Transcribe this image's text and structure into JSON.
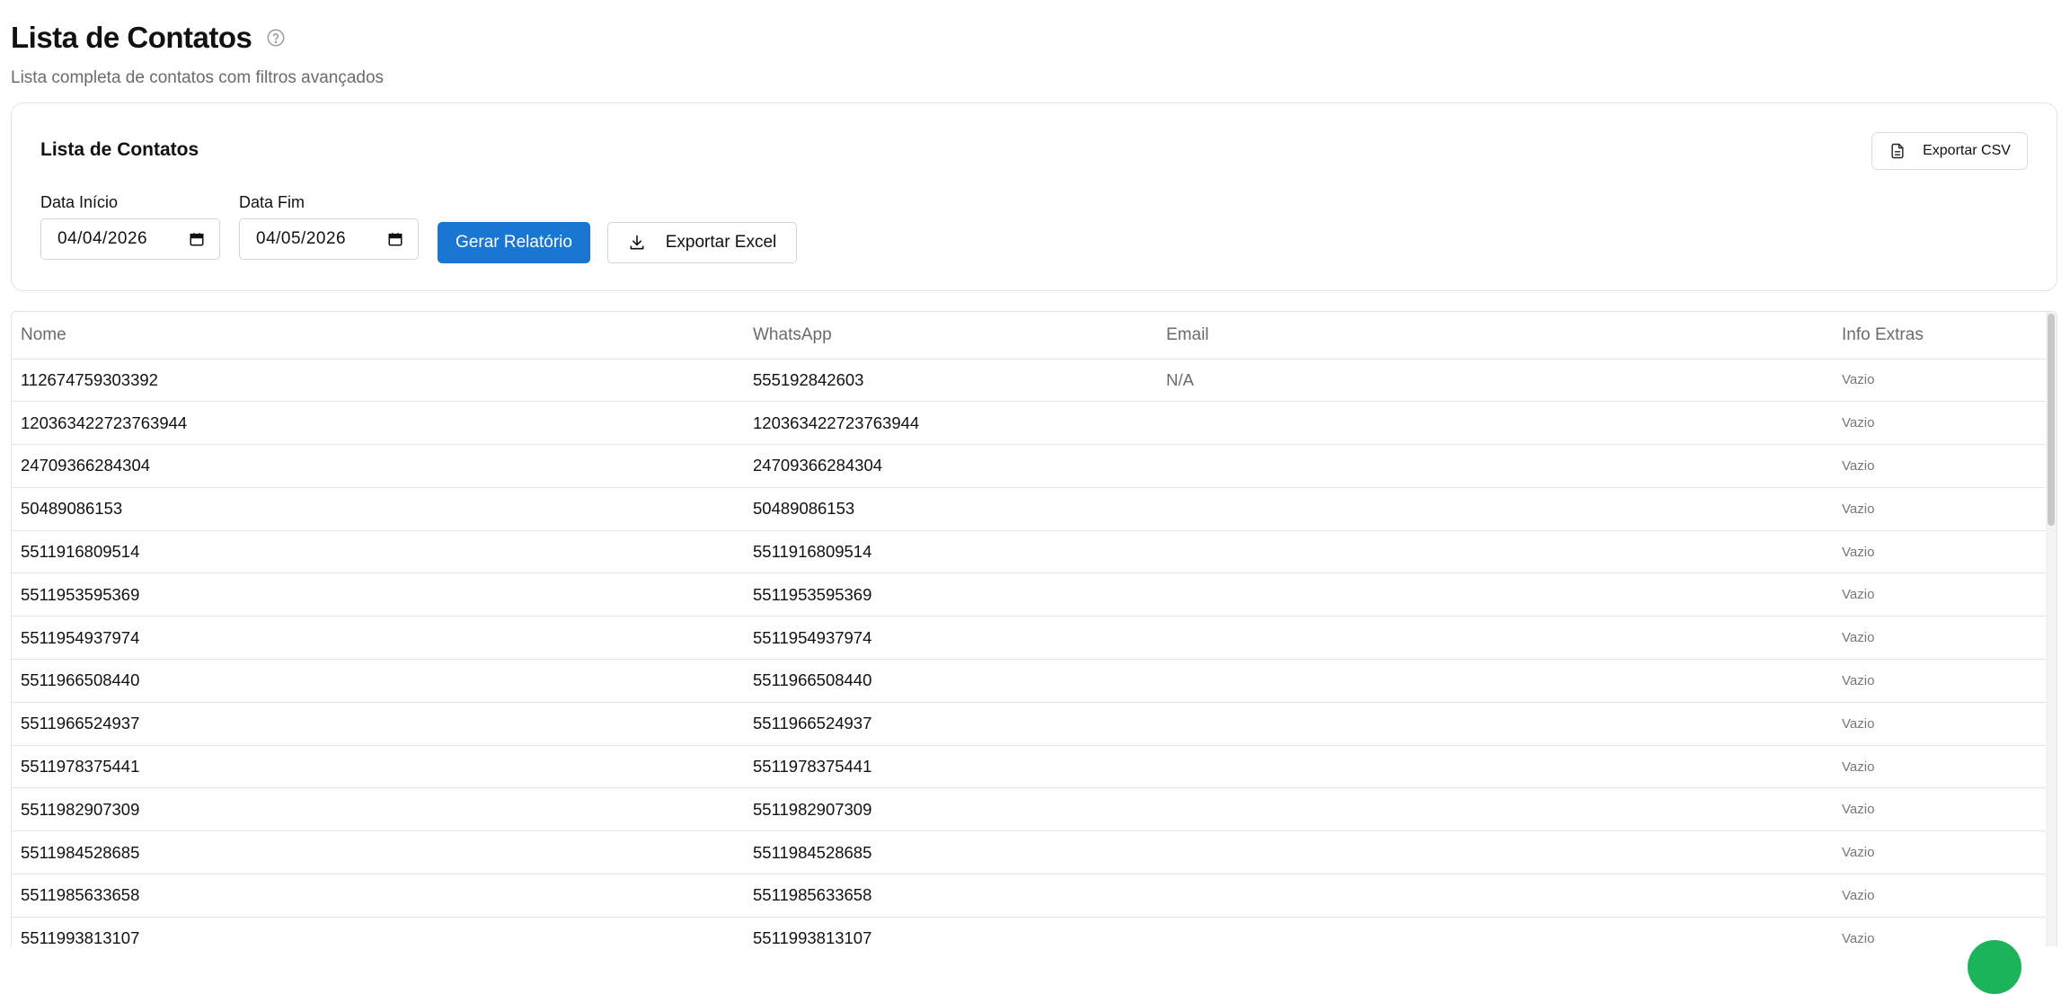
{
  "header": {
    "title": "Lista de Contatos",
    "subtitle": "Lista completa de contatos com filtros avançados",
    "help_icon": "help-circle-icon"
  },
  "filters": {
    "card_title": "Lista de Contatos",
    "export_csv_label": "Exportar CSV",
    "start_label": "Data Início",
    "start_value": "04/04/2026",
    "end_label": "Data Fim",
    "end_value": "04/05/2026",
    "generate_label": "Gerar Relatório",
    "export_excel_label": "Exportar Excel"
  },
  "table": {
    "columns": [
      "Nome",
      "WhatsApp",
      "Email",
      "Info Extras"
    ],
    "rows": [
      {
        "nome": "112674759303392",
        "whatsapp": "555192842603",
        "email": "N/A",
        "extra": "Vazio"
      },
      {
        "nome": "120363422723763944",
        "whatsapp": "120363422723763944",
        "email": "",
        "extra": "Vazio"
      },
      {
        "nome": "24709366284304",
        "whatsapp": "24709366284304",
        "email": "",
        "extra": "Vazio"
      },
      {
        "nome": "50489086153",
        "whatsapp": "50489086153",
        "email": "",
        "extra": "Vazio"
      },
      {
        "nome": "5511916809514",
        "whatsapp": "5511916809514",
        "email": "",
        "extra": "Vazio"
      },
      {
        "nome": "5511953595369",
        "whatsapp": "5511953595369",
        "email": "",
        "extra": "Vazio"
      },
      {
        "nome": "5511954937974",
        "whatsapp": "5511954937974",
        "email": "",
        "extra": "Vazio"
      },
      {
        "nome": "5511966508440",
        "whatsapp": "5511966508440",
        "email": "",
        "extra": "Vazio"
      },
      {
        "nome": "5511966524937",
        "whatsapp": "5511966524937",
        "email": "",
        "extra": "Vazio"
      },
      {
        "nome": "5511978375441",
        "whatsapp": "5511978375441",
        "email": "",
        "extra": "Vazio"
      },
      {
        "nome": "5511982907309",
        "whatsapp": "5511982907309",
        "email": "",
        "extra": "Vazio"
      },
      {
        "nome": "5511984528685",
        "whatsapp": "5511984528685",
        "email": "",
        "extra": "Vazio"
      },
      {
        "nome": "5511985633658",
        "whatsapp": "5511985633658",
        "email": "",
        "extra": "Vazio"
      },
      {
        "nome": "5511993813107",
        "whatsapp": "5511993813107",
        "email": "",
        "extra": "Vazio"
      }
    ]
  },
  "colors": {
    "primary": "#1976d2",
    "fab": "#1bb45a",
    "border": "#e4e4e7",
    "muted_text": "#6b6b6b"
  }
}
